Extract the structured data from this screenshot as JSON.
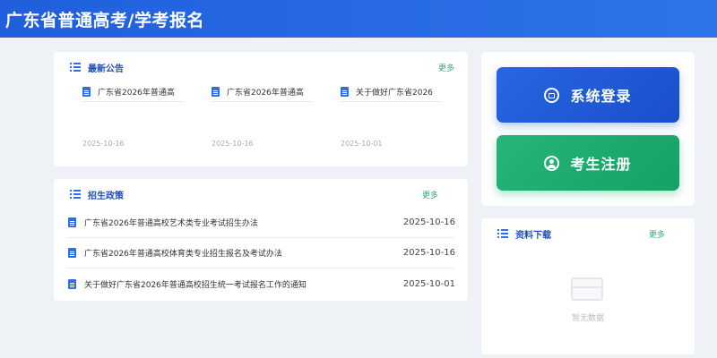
{
  "header": {
    "title": "广东省普通高考/学考报名"
  },
  "announcements": {
    "title": "最新公告",
    "more": "更多",
    "items": [
      {
        "title": "广东省2026年普通高",
        "date": "2025-10-16"
      },
      {
        "title": "广东省2026年普通高",
        "date": "2025-10-16"
      },
      {
        "title": "关于做好广东省2026",
        "date": "2025-10-01"
      }
    ]
  },
  "policy": {
    "title": "招生政策",
    "more": "更多",
    "items": [
      {
        "title": "广东省2026年普通高校艺术类专业考试招生办法",
        "date": "2025-10-16"
      },
      {
        "title": "广东省2026年普通高校体育类专业招生报名及考试办法",
        "date": "2025-10-16"
      },
      {
        "title": "关于做好广东省2026年普通高校招生统一考试报名工作的通知",
        "date": "2025-10-01"
      }
    ]
  },
  "actions": {
    "login_label": "系统登录",
    "register_label": "考生注册",
    "login_icon": "lock-icon",
    "register_icon": "user-icon"
  },
  "downloads": {
    "title": "资料下载",
    "more": "更多",
    "empty_text": "暂无数据"
  },
  "colors": {
    "header": "#2366e0",
    "accent_blue": "#2f6ee6",
    "login_button": "#1f5bd8",
    "register_button": "#1fae6f",
    "more_link": "#3aa37a"
  }
}
